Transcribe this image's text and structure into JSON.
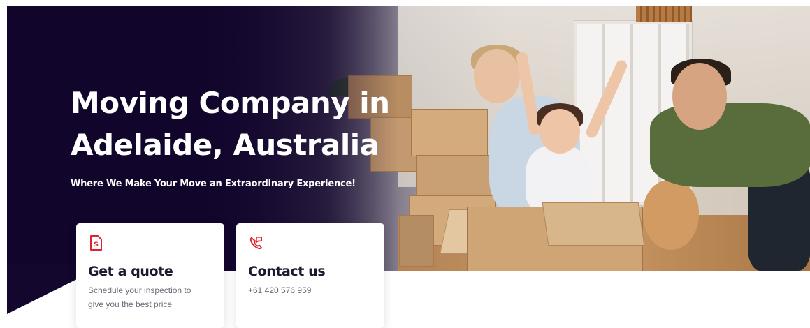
{
  "hero": {
    "headline_line1": "Moving Company in",
    "headline_line2": "Adelaide, Australia",
    "subheadline": "Where We Make Your Move an Extraordinary Experience!"
  },
  "cards": {
    "quote": {
      "icon": "dollar-document-icon",
      "title": "Get a quote",
      "description": "Schedule your inspection to give you the best price"
    },
    "contact": {
      "icon": "phone-icon",
      "title": "Contact us",
      "phone": "+61 420 576 959"
    }
  },
  "colors": {
    "hero_dark": "#14072e",
    "accent_red": "#e0202e",
    "card_title": "#1a1a2e",
    "card_text": "#6c6c78"
  }
}
